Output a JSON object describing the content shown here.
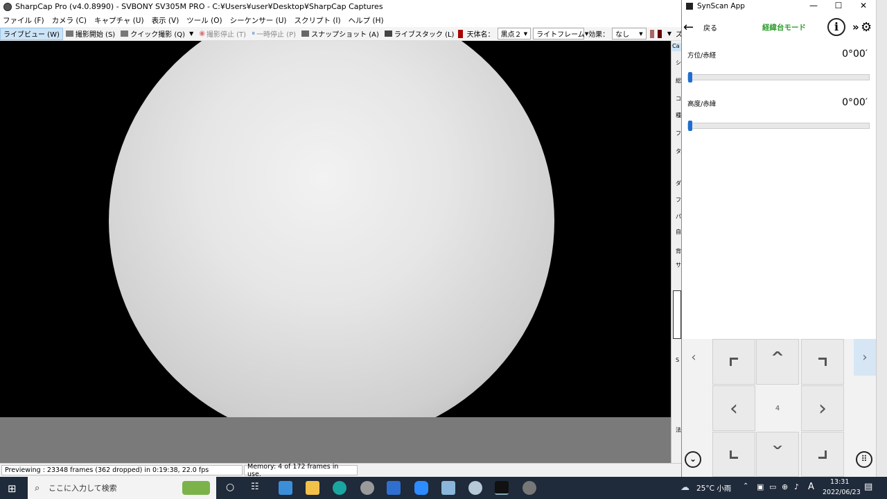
{
  "sharpcap": {
    "title": "SharpCap Pro (v4.0.8990) - SVBONY SV305M PRO - C:¥Users¥user¥Desktop¥SharpCap Captures",
    "menu": [
      "ファイル (F)",
      "カメラ (C)",
      "キャプチャ (U)",
      "表示 (V)",
      "ツール (O)",
      "シーケンサー (U)",
      "スクリプト (I)",
      "ヘルプ (H)"
    ],
    "toolbar": {
      "live_view": "ライブビュー (W)",
      "start_capture": "撮影開始 (S)",
      "quick_capture": "クイック撮影 (Q)",
      "stop_capture": "撮影停止 (T)",
      "pause": "一時停止 (P)",
      "snapshot": "スナップショット (A)",
      "live_stack": "ライブスタック (L)",
      "target_label": "天体名：",
      "target_value": "黒点２",
      "frame_type": "ライトフレーム",
      "effect_label": "効果：",
      "effect_value": "なし",
      "zoom_label": "ズ"
    },
    "status": {
      "preview": "Previewing : 23348 frames (362 dropped) in 0:19:38, 22.0 fps",
      "memory": "Memory: 4 of 172 frames in use."
    },
    "sidebar_chars": [
      "Ca",
      "シ",
      "総",
      "コ",
      "種",
      "フ",
      "タ",
      "ダ",
      "フ",
      "パ",
      "自",
      "背",
      "サ",
      "S",
      "法"
    ]
  },
  "synscan": {
    "title": "SynScan App",
    "back_label": "戻る",
    "mode_title": "経緯台モード",
    "mode_color": "#2e9c2e",
    "azimuth_label": "方位/赤経",
    "azimuth_value": "0°00′",
    "altitude_label": "高度/赤緯",
    "altitude_value": "0°00′",
    "speed": "4"
  },
  "taskbar": {
    "search_placeholder": "ここに入力して検索",
    "weather": "25°C 小雨",
    "time": "13:31",
    "date": "2022/06/23",
    "ime": "A"
  }
}
